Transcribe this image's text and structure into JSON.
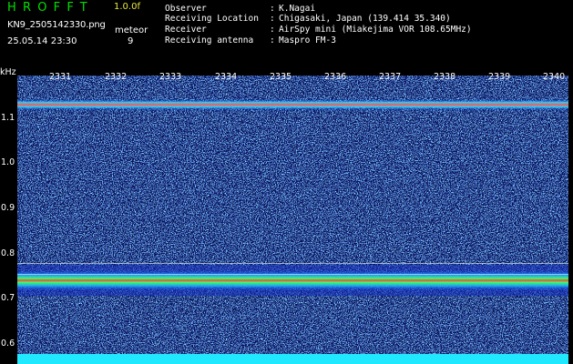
{
  "header": {
    "brand": "HROFFT",
    "version": "1.0.0f",
    "filename": "KN9_2505142330.png",
    "meteor_label": "meteor",
    "datetime": "25.05.14 23:30",
    "meteor_count": "9"
  },
  "info": [
    {
      "label": "Observer",
      "value": "K.Nagai"
    },
    {
      "label": "Receiving Location",
      "value": "Chigasaki, Japan (139.414 35.340)"
    },
    {
      "label": "Receiver",
      "value": "AirSpy mini (Miakejima VOR 108.65MHz)"
    },
    {
      "label": "Receiving antenna",
      "value": "Maspro FM-3"
    }
  ],
  "axis": {
    "y_unit": "kHz",
    "y_ticks": [
      "1.1",
      "1.0",
      "0.9",
      "0.8",
      "0.7",
      "0.6"
    ],
    "x_ticks": [
      "2331",
      "2332",
      "2333",
      "2334",
      "2335",
      "2336",
      "2337",
      "2338",
      "2339",
      "2340"
    ]
  },
  "colors": {
    "background": "#000000",
    "plot_base": "#0a1055",
    "brand_green": "#00e000",
    "version_yellow": "#e8e840"
  }
}
